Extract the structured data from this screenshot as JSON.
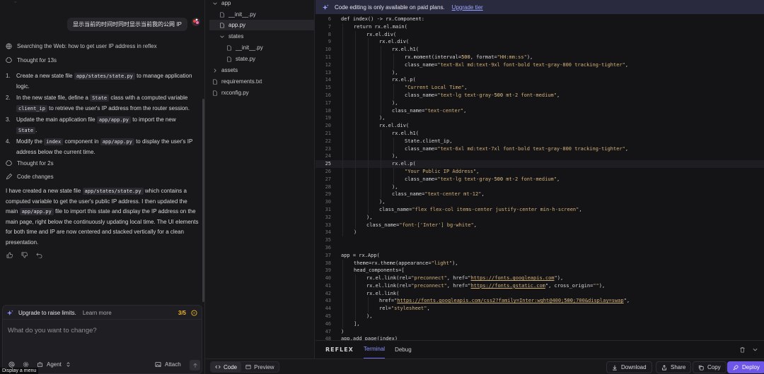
{
  "chat": {
    "user_message": "显示当前的时间时同时显示当前我的公网 IP",
    "steps": {
      "search": "Searching the Web: how to get user IP address in reflex",
      "thought1": "Thought for 13s",
      "thought2": "Thought for 2s",
      "code_changes": "Code changes"
    },
    "plan": [
      {
        "num": "1.",
        "pre": "Create a new state file ",
        "code": "app/states/state.py",
        "post": " to manage application logic.",
        "code2": "",
        "post2": ""
      },
      {
        "num": "2.",
        "pre": "In the new state file, define a ",
        "code": "State",
        "post": " class with a computed variable ",
        "code2": "client_ip",
        "post2": " to retrieve the user's IP address from the router session."
      },
      {
        "num": "3.",
        "pre": "Update the main application file ",
        "code": "app/app.py",
        "post": " to import the new ",
        "code2": "State",
        "post2": "."
      },
      {
        "num": "4.",
        "pre": "Modify the ",
        "code": "index",
        "post": " component in ",
        "code2": "app/app.py",
        "post2": " to display the user's IP address below the current time."
      }
    ],
    "summary": {
      "p1": "I have created a new state file ",
      "c1": "app/states/state.py",
      "p2": " which contains a computed variable to get the user's public IP address. I then updated the main ",
      "c2": "app/app.py",
      "p3": " file to import this state and display the IP address on the main page, right below the continuously updating local time. The UI elements for both time and IP are now centered and stacked vertically for a clean presentation."
    },
    "upgrade": {
      "text": "Upgrade to raise limits.",
      "learn": "Learn more",
      "count": "3/5"
    },
    "composer": {
      "placeholder": "What do you want to change?",
      "agent_label": "Agent",
      "attach_label": "Attach"
    },
    "tooltip": "Display a menu"
  },
  "tree": {
    "app": "app",
    "init1": "__init__.py",
    "app_py": "app.py",
    "states": "states",
    "init2": "__init__.py",
    "state_py": "state.py",
    "assets": "assets",
    "requirements": "requirements.txt",
    "rxconfig": "rxconfig.py"
  },
  "banner": {
    "text": "Code editing is only available on paid plans.",
    "link": "Upgrade tier"
  },
  "editor": {
    "active_line": 25,
    "lines": [
      {
        "n": "6",
        "indent": 0,
        "t": "def index() -> rx.Component:"
      },
      {
        "n": "7",
        "indent": 1,
        "t": "return rx.el.main("
      },
      {
        "n": "8",
        "indent": 2,
        "t": "rx.el.div("
      },
      {
        "n": "9",
        "indent": 3,
        "t": "rx.el.div("
      },
      {
        "n": "10",
        "indent": 4,
        "t": "rx.el.h1("
      },
      {
        "n": "11",
        "indent": 5,
        "t": "rx.moment(interval=500, format=\"HH:mm:ss\"),"
      },
      {
        "n": "12",
        "indent": 5,
        "t": "class_name=\"text-8xl md:text-9xl font-bold text-gray-800 tracking-tighter\","
      },
      {
        "n": "13",
        "indent": 4,
        "t": "),"
      },
      {
        "n": "14",
        "indent": 4,
        "t": "rx.el.p("
      },
      {
        "n": "15",
        "indent": 5,
        "t": "\"Current Local Time\","
      },
      {
        "n": "16",
        "indent": 5,
        "t": "class_name=\"text-lg text-gray-500 mt-2 font-medium\","
      },
      {
        "n": "17",
        "indent": 4,
        "t": "),"
      },
      {
        "n": "18",
        "indent": 4,
        "t": "class_name=\"text-center\","
      },
      {
        "n": "19",
        "indent": 3,
        "t": "),"
      },
      {
        "n": "20",
        "indent": 3,
        "t": "rx.el.div("
      },
      {
        "n": "21",
        "indent": 4,
        "t": "rx.el.h1("
      },
      {
        "n": "22",
        "indent": 5,
        "t": "State.client_ip,"
      },
      {
        "n": "23",
        "indent": 5,
        "t": "class_name=\"text-6xl md:text-7xl font-bold text-gray-800 tracking-tighter\","
      },
      {
        "n": "24",
        "indent": 4,
        "t": "),"
      },
      {
        "n": "25",
        "indent": 4,
        "t": "rx.el.p("
      },
      {
        "n": "26",
        "indent": 5,
        "t": "\"Your Public IP Address\","
      },
      {
        "n": "27",
        "indent": 5,
        "t": "class_name=\"text-lg text-gray-500 mt-2 font-medium\","
      },
      {
        "n": "28",
        "indent": 4,
        "t": "),"
      },
      {
        "n": "29",
        "indent": 4,
        "t": "class_name=\"text-center mt-12\","
      },
      {
        "n": "30",
        "indent": 3,
        "t": "),"
      },
      {
        "n": "31",
        "indent": 3,
        "t": "class_name=\"flex flex-col items-center justify-center min-h-screen\","
      },
      {
        "n": "32",
        "indent": 2,
        "t": "),"
      },
      {
        "n": "33",
        "indent": 2,
        "t": "class_name=\"font-['Inter'] bg-white\","
      },
      {
        "n": "34",
        "indent": 1,
        "t": ")"
      },
      {
        "n": "35",
        "indent": 0,
        "t": ""
      },
      {
        "n": "36",
        "indent": 0,
        "t": ""
      },
      {
        "n": "37",
        "indent": 0,
        "t": "app = rx.App("
      },
      {
        "n": "38",
        "indent": 1,
        "t": "theme=rx.theme(appearance=\"light\"),"
      },
      {
        "n": "39",
        "indent": 1,
        "t": "head_components=["
      },
      {
        "n": "40",
        "indent": 2,
        "t": "rx.el.link(rel=\"preconnect\", href=\"https://fonts.googleapis.com\"),"
      },
      {
        "n": "41",
        "indent": 2,
        "t": "rx.el.link(rel=\"preconnect\", href=\"https://fonts.gstatic.com\", cross_origin=\"\"),"
      },
      {
        "n": "42",
        "indent": 2,
        "t": "rx.el.link("
      },
      {
        "n": "43",
        "indent": 3,
        "t": "href=\"https://fonts.googleapis.com/css2?family=Inter:wght@400;500;700&display=swap\","
      },
      {
        "n": "44",
        "indent": 3,
        "t": "rel=\"stylesheet\","
      },
      {
        "n": "45",
        "indent": 2,
        "t": "),"
      },
      {
        "n": "46",
        "indent": 1,
        "t": "],"
      },
      {
        "n": "47",
        "indent": 0,
        "t": ")"
      },
      {
        "n": "48",
        "indent": 0,
        "t": "app.add_page(index)"
      }
    ]
  },
  "panel": {
    "brand": "REFLEX",
    "tab_terminal": "Terminal",
    "tab_debug": "Debug"
  },
  "footer": {
    "code": "Code",
    "preview": "Preview",
    "download": "Download",
    "share": "Share",
    "copy": "Copy",
    "deploy": "Deploy"
  },
  "colors": {
    "accent": "#6e56e8",
    "tab_accent": "#8b93ff",
    "count": "#f0b429"
  }
}
